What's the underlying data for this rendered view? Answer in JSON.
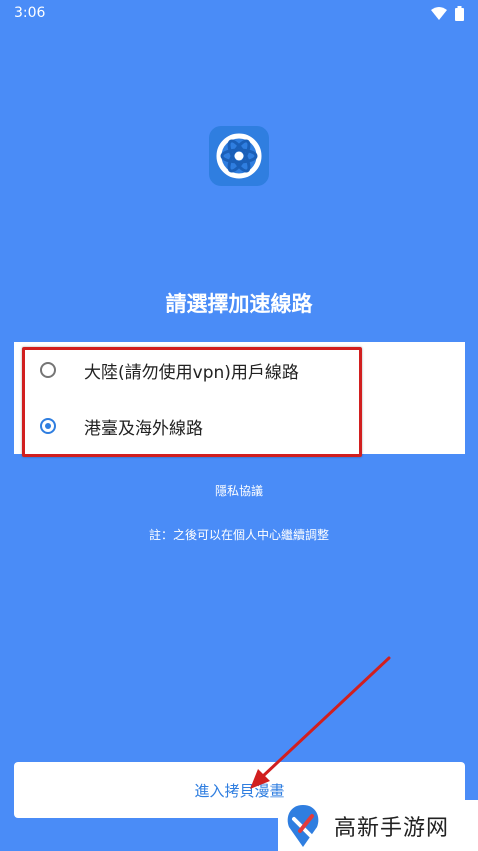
{
  "status_bar": {
    "time": "3:06",
    "icons": [
      "wifi-icon",
      "battery-icon"
    ]
  },
  "app_logo": {
    "icon": "atom-logo-icon"
  },
  "title": "請選擇加速線路",
  "options": [
    {
      "label": "大陸(請勿使用vpn)用戶線路",
      "checked": false
    },
    {
      "label": "港臺及海外線路",
      "checked": true
    }
  ],
  "privacy_link": "隱私協議",
  "note": "註：之後可以在個人中心繼續調整",
  "enter_button": "進入拷貝漫畫",
  "watermark": {
    "text": "高新手游网"
  },
  "colors": {
    "background": "#4a8cf7",
    "accent": "#2f7ee0",
    "annotation_red": "#d11f1f"
  }
}
